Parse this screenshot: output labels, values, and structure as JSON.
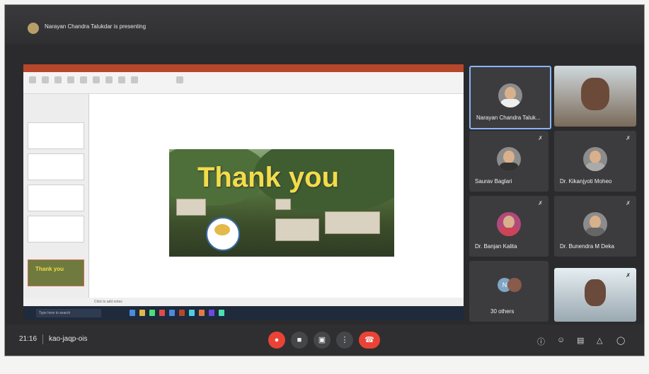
{
  "meet": {
    "presenting_text": "Narayan Chandra Talukdar is presenting",
    "time": "21:16",
    "meeting_code": "kao-jaqp-ois",
    "participants": [
      {
        "name": "Narayan Chandra Taluk..."
      },
      {
        "name": ""
      },
      {
        "name": "Saurav Baglari"
      },
      {
        "name": "Dr. Kikanjyoti Moheo"
      },
      {
        "name": "Dr. Banjan Kalita"
      },
      {
        "name": "Dr. Bunendra M Deka"
      },
      {
        "name": "30 others"
      },
      {
        "name": ""
      }
    ]
  },
  "slide": {
    "title": "Thank you",
    "thumb_label": "Thank you",
    "status_text": "Click to add notes"
  },
  "taskbar": {
    "search_placeholder": "Type here to search"
  },
  "colors": {
    "accent_red": "#ea4335",
    "active_border": "#8ab4f8",
    "slide_text": "#f2dc4a"
  },
  "icons": [
    "mic-off-icon",
    "camera-icon",
    "present-icon",
    "more-icon",
    "hang-up-icon",
    "info-icon",
    "people-icon",
    "chat-icon",
    "activities-icon",
    "lock-icon"
  ]
}
